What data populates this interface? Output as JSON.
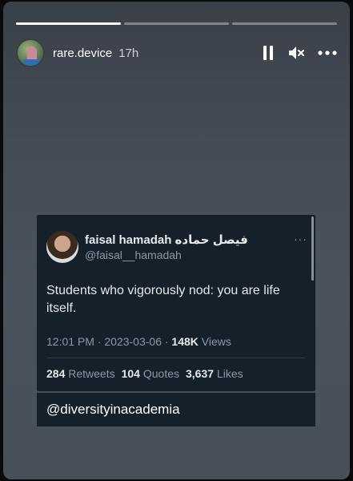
{
  "story": {
    "progress": [
      1.0,
      0.0,
      0.0
    ],
    "username": "rare.device",
    "time": "17h"
  },
  "controls": {
    "pause_icon": "pause-icon",
    "mute_icon": "mute-icon",
    "more_icon": "more-icon"
  },
  "tweet": {
    "name": "faisal hamadah فيصل حماده",
    "handle": "@faisal__hamadah",
    "more": "···",
    "text": "Students who vigorously nod: you are life itself.",
    "timestamp": "12:01 PM · 2023-03-06 · ",
    "views_count": "148K",
    "views_label": " Views",
    "retweets_count": "284",
    "retweets_label": "Retweets",
    "quotes_count": "104",
    "quotes_label": "Quotes",
    "likes_count": "3,637",
    "likes_label": "Likes"
  },
  "caption": "@diversityinacademia",
  "colors": {
    "tweet_bg": "#15202b",
    "muted": "#8b98a5",
    "text": "#e7e9ea"
  }
}
